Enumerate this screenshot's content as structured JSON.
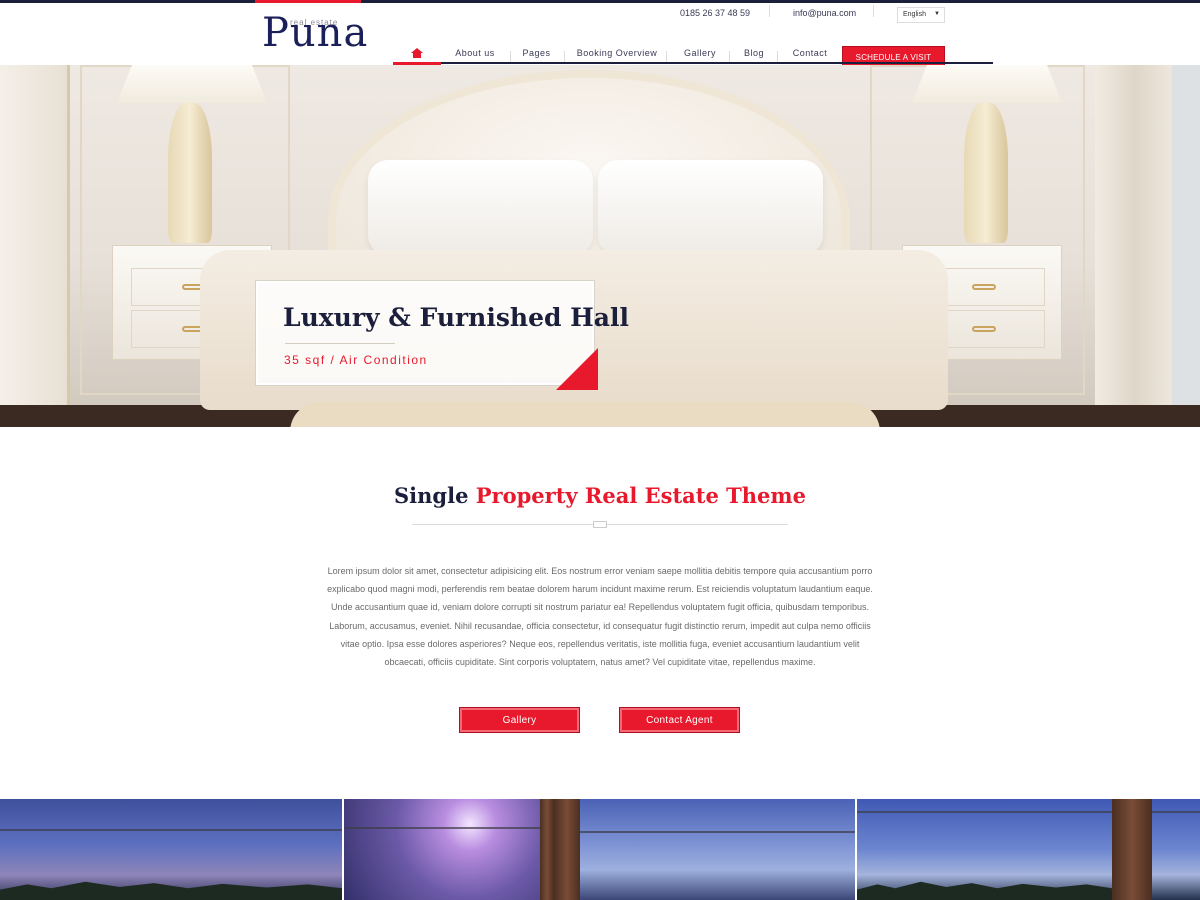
{
  "brand": {
    "name": "Puna",
    "tagline": "real estate",
    "accent_color": "#e8192c",
    "navy_color": "#1b1f3b"
  },
  "topbar": {
    "phone": "0185 26 37 48 59",
    "email": "info@puna.com",
    "language": "English"
  },
  "nav": {
    "home_icon": "home-icon",
    "items": [
      "About us",
      "Pages",
      "Booking Overview",
      "Gallery",
      "Blog",
      "Contact"
    ],
    "cta": "SCHEDULE A VISIT"
  },
  "hero": {
    "title": "Luxury & Furnished Hall",
    "subtitle": "35 sqf / Air Condition"
  },
  "intro": {
    "title_plain": "Single",
    "title_accent": "Property Real Estate Theme",
    "body": "Lorem ipsum dolor sit amet, consectetur adipisicing elit. Eos nostrum error veniam saepe mollitia debitis tempore quia accusantium porro explicabo quod magni modi, perferendis rem beatae dolorem harum incidunt maxime rerum. Est reiciendis voluptatum laudantium eaque. Unde accusantium quae id, veniam dolore corrupti sit nostrum pariatur ea! Repellendus voluptatem fugit officia, quibusdam temporibus. Laborum, accusamus, eveniet. Nihil recusandae, officia consectetur, id consequatur fugit distinctio rerum, impedit aut culpa nemo officiis vitae optio. Ipsa esse dolores asperiores? Neque eos, repellendus veritatis, iste mollitia fuga, eveniet accusantium laudantium velit obcaecati, officiis cupiditate. Sint corporis voluptatem, natus amet? Vel cupiditate vitae, repellendus maxime.",
    "button_gallery": "Gallery",
    "button_agent": "Contact Agent"
  }
}
